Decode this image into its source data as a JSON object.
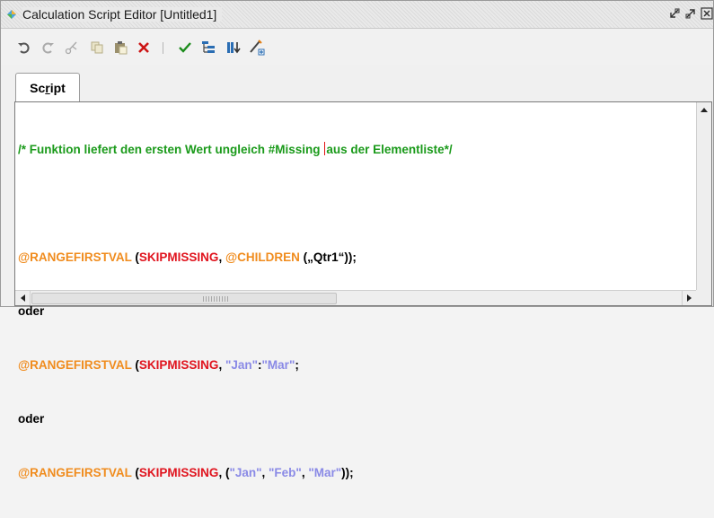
{
  "window": {
    "title": "Calculation Script Editor [Untitled1]",
    "controls": [
      "restore-icon",
      "minimize-icon",
      "close-icon"
    ]
  },
  "toolbar": {
    "buttons": [
      {
        "name": "undo-icon"
      },
      {
        "name": "redo-icon"
      },
      {
        "name": "cut-icon"
      },
      {
        "name": "copy-icon"
      },
      {
        "name": "paste-icon"
      },
      {
        "name": "delete-icon"
      },
      {
        "name": "separator"
      },
      {
        "name": "check-syntax-icon"
      },
      {
        "name": "outline-icon"
      },
      {
        "name": "insert-icon"
      },
      {
        "name": "pencil-icon"
      }
    ]
  },
  "tabs": [
    {
      "label_pre": "Sc",
      "label_u": "r",
      "label_post": "ipt",
      "active": true
    }
  ],
  "editor": {
    "line1": {
      "comment_a": "/* Funktion liefert den ersten Wert ungleich #Missing ",
      "comment_b": "aus der Elementliste*/"
    },
    "line3": {
      "func1": "@RANGEFIRSTVAL",
      "p1": " (",
      "kw": "SKIPMISSING",
      "p2": ", ",
      "func2": "@CHILDREN",
      "p3": " („Qtr1“));"
    },
    "line4": {
      "text": "oder"
    },
    "line5": {
      "func": "@RANGEFIRSTVAL",
      "p1": " (",
      "kw": "SKIPMISSING",
      "p2": ", ",
      "s1": "\"Jan\"",
      "p3": ":",
      "s2": "\"Mar\"",
      "p4": ";"
    },
    "line6": {
      "text": "oder"
    },
    "line7": {
      "func": "@RANGEFIRSTVAL",
      "p1": " (",
      "kw": "SKIPMISSING",
      "p2": ", (",
      "s1": "\"Jan\"",
      "p3": ", ",
      "s2": "\"Feb\"",
      "p4": ", ",
      "s3": "\"Mar\"",
      "p5": "));"
    }
  },
  "colors": {
    "comment": "#1a9a1a",
    "function": "#f08c1e",
    "keyword": "#e0141e",
    "string": "#8a8ae6",
    "caret": "#e01010"
  }
}
